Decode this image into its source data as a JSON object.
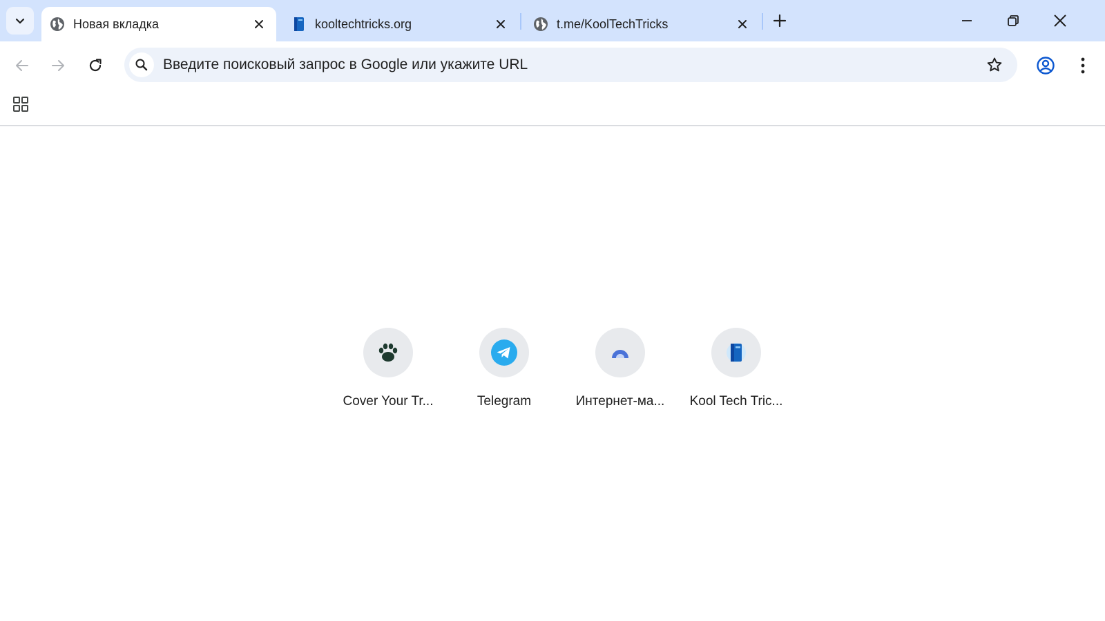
{
  "tabs": [
    {
      "title": "Новая вкладка",
      "favicon": "globe-icon",
      "active": true
    },
    {
      "title": "kooltechtricks.org",
      "favicon": "book-icon",
      "active": false
    },
    {
      "title": "t.me/KoolTechTricks",
      "favicon": "globe-icon",
      "active": false
    }
  ],
  "omnibox": {
    "placeholder": "Введите поисковый запрос в Google или укажите URL"
  },
  "shortcuts": [
    {
      "label": "Cover Your Tr...",
      "icon": "paw-icon"
    },
    {
      "label": "Telegram",
      "icon": "telegram-icon"
    },
    {
      "label": "Интернет-ма...",
      "icon": "arc-icon"
    },
    {
      "label": "Kool Tech Tric...",
      "icon": "book-icon"
    }
  ],
  "colors": {
    "tabstrip": "#d3e3fd",
    "omnibox": "#edf2fa",
    "accent": "#0b57d0",
    "telegram": "#2aabee",
    "paw": "#1e3a2f"
  }
}
